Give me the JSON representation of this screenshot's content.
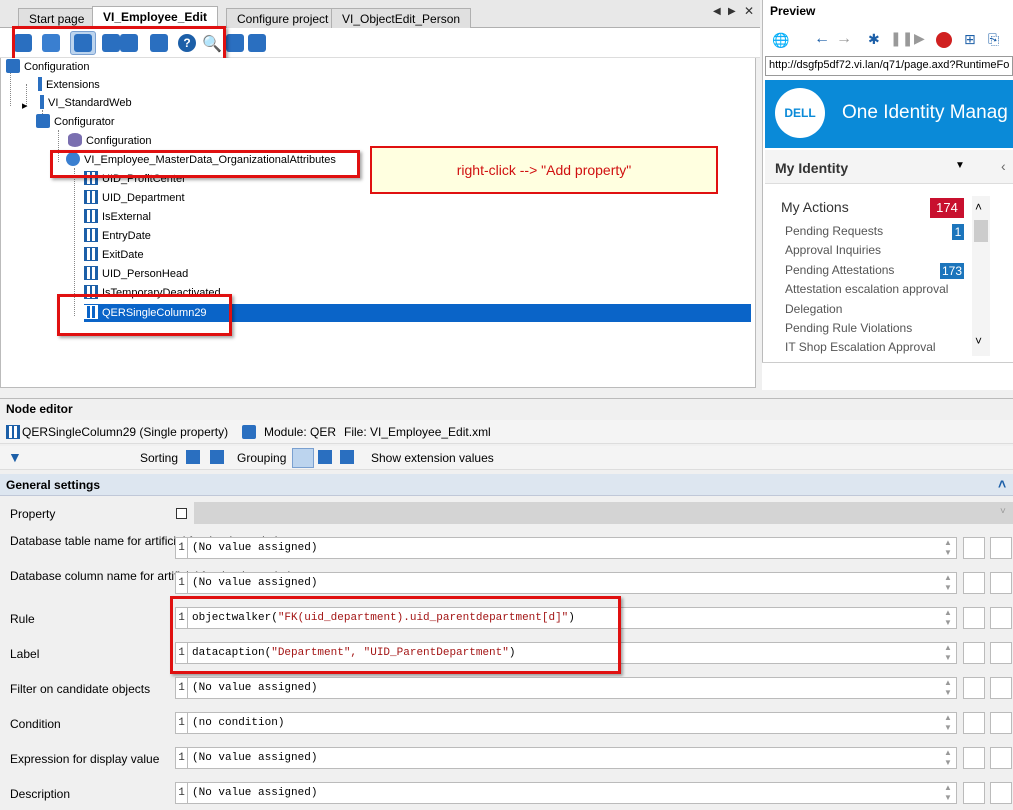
{
  "tabs": [
    {
      "label": "Start page",
      "active": false
    },
    {
      "label": "VI_Employee_Edit",
      "active": true
    },
    {
      "label": "Configure project",
      "active": false
    },
    {
      "label": "VI_ObjectEdit_Person",
      "active": false
    }
  ],
  "tree": {
    "root": "Configuration",
    "extensions": "Extensions",
    "standardweb": "VI_StandardWeb",
    "configurator": "Configurator",
    "configuration": "Configuration",
    "masterdata": "VI_Employee_MasterData_OrganizationalAttributes",
    "columns": [
      "UID_ProfitCenter",
      "UID_Department",
      "IsExternal",
      "EntryDate",
      "ExitDate",
      "UID_PersonHead",
      "IsTemporaryDeactivated"
    ],
    "selected": "QERSingleColumn29"
  },
  "callout": "right-click --> \"Add property\"",
  "preview": {
    "title": "Preview",
    "url": "http://dsgfp5df72.vi.lan/q71/page.axd?RuntimeFo",
    "logo": "DELL",
    "brand": "One Identity Manag",
    "my_identity": "My Identity",
    "my_actions": "My Actions",
    "my_actions_count": "174",
    "items": [
      {
        "label": "Pending Requests",
        "count": "1"
      },
      {
        "label": "Approval Inquiries",
        "count": ""
      },
      {
        "label": "Pending Attestations",
        "count": "173"
      },
      {
        "label": "Attestation escalation approval",
        "count": ""
      },
      {
        "label": "Delegation",
        "count": ""
      },
      {
        "label": "Pending Rule Violations",
        "count": ""
      },
      {
        "label": "IT Shop Escalation Approval",
        "count": ""
      }
    ],
    "colors": {
      "banner": "#0a8ad8",
      "badge_red": "#c8102e",
      "badge_blue": "#1c75bc"
    }
  },
  "node_editor": {
    "title": "Node editor",
    "node": "QERSingleColumn29 (Single property)",
    "module": "Module: QER",
    "file": "File: VI_Employee_Edit.xml",
    "sorting": "Sorting",
    "grouping": "Grouping",
    "show_ext": "Show extension values",
    "general_settings": "General settings",
    "property_label": "Property",
    "rows": [
      {
        "label": "Database table name for artificial foreign-key relation",
        "line": "1",
        "value": "(No value assigned)"
      },
      {
        "label": "Database column name for artificial foreign-key relation",
        "line": "1",
        "value": "(No value assigned)"
      },
      {
        "label": "Rule",
        "line": "1",
        "value_prefix": "objectwalker(",
        "value_string": "\"FK(uid_department).uid_parentdepartment[d]\"",
        "value_suffix": ")"
      },
      {
        "label": "Label",
        "line": "1",
        "value_prefix": "datacaption(",
        "value_string": "\"Department\", \"UID_ParentDepartment\"",
        "value_suffix": ")"
      },
      {
        "label": "Filter on candidate objects",
        "line": "1",
        "value": "(No value assigned)"
      },
      {
        "label": "Condition",
        "line": "1",
        "value": "(no condition)"
      },
      {
        "label": "Expression for display value",
        "line": "1",
        "value": "(No value assigned)"
      },
      {
        "label": "Description",
        "line": "1",
        "value": "(No value assigned)"
      }
    ]
  }
}
